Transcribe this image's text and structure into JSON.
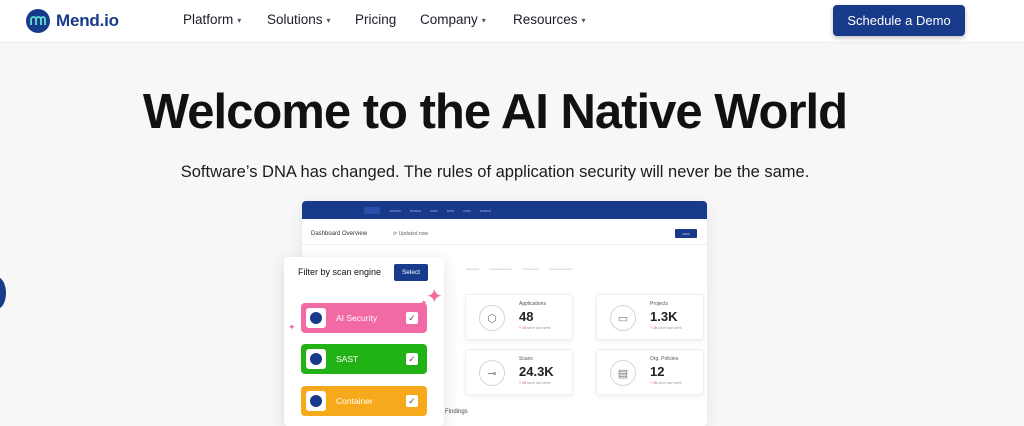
{
  "brand": {
    "name": "Mend.io",
    "color": "#173a8a"
  },
  "nav": {
    "items": [
      {
        "label": "Platform",
        "dropdown": true
      },
      {
        "label": "Solutions",
        "dropdown": true
      },
      {
        "label": "Pricing",
        "dropdown": false
      },
      {
        "label": "Company",
        "dropdown": true
      },
      {
        "label": "Resources",
        "dropdown": true
      }
    ],
    "cta_label": "Schedule a Demo"
  },
  "hero": {
    "title_regular": "Welcome to the ",
    "title_bold": "AI Native World",
    "subtitle": "Software’s DNA has changed. The rules of application security will never be the same."
  },
  "dashboard": {
    "overview_label": "Dashboard Overview",
    "updated_label": "Updated now",
    "cards": [
      {
        "label": "Applications",
        "value": "48",
        "delta": "+ 15",
        "delta_suffix": "since last week",
        "icon": "cube-icon"
      },
      {
        "label": "Projects",
        "value": "1.3K",
        "delta": "+ 15",
        "delta_suffix": "since last week",
        "icon": "folder-icon"
      },
      {
        "label": "Scans",
        "value": "24.3K",
        "delta": "+ 15",
        "delta_suffix": "since last week",
        "icon": "commit-icon"
      },
      {
        "label": "Org. Policies",
        "value": "12",
        "delta": "+ 15",
        "delta_suffix": "since last week",
        "icon": "clipboard-icon"
      }
    ],
    "findings_label": "Findings"
  },
  "filter": {
    "title": "Filter by scan engine",
    "select_label": "Select",
    "engines": [
      {
        "label": "AI Security",
        "color": "#f26aa3",
        "checked": true
      },
      {
        "label": "SAST",
        "color": "#21b316",
        "checked": true
      },
      {
        "label": "Container",
        "color": "#f6a91b",
        "checked": true
      }
    ]
  }
}
